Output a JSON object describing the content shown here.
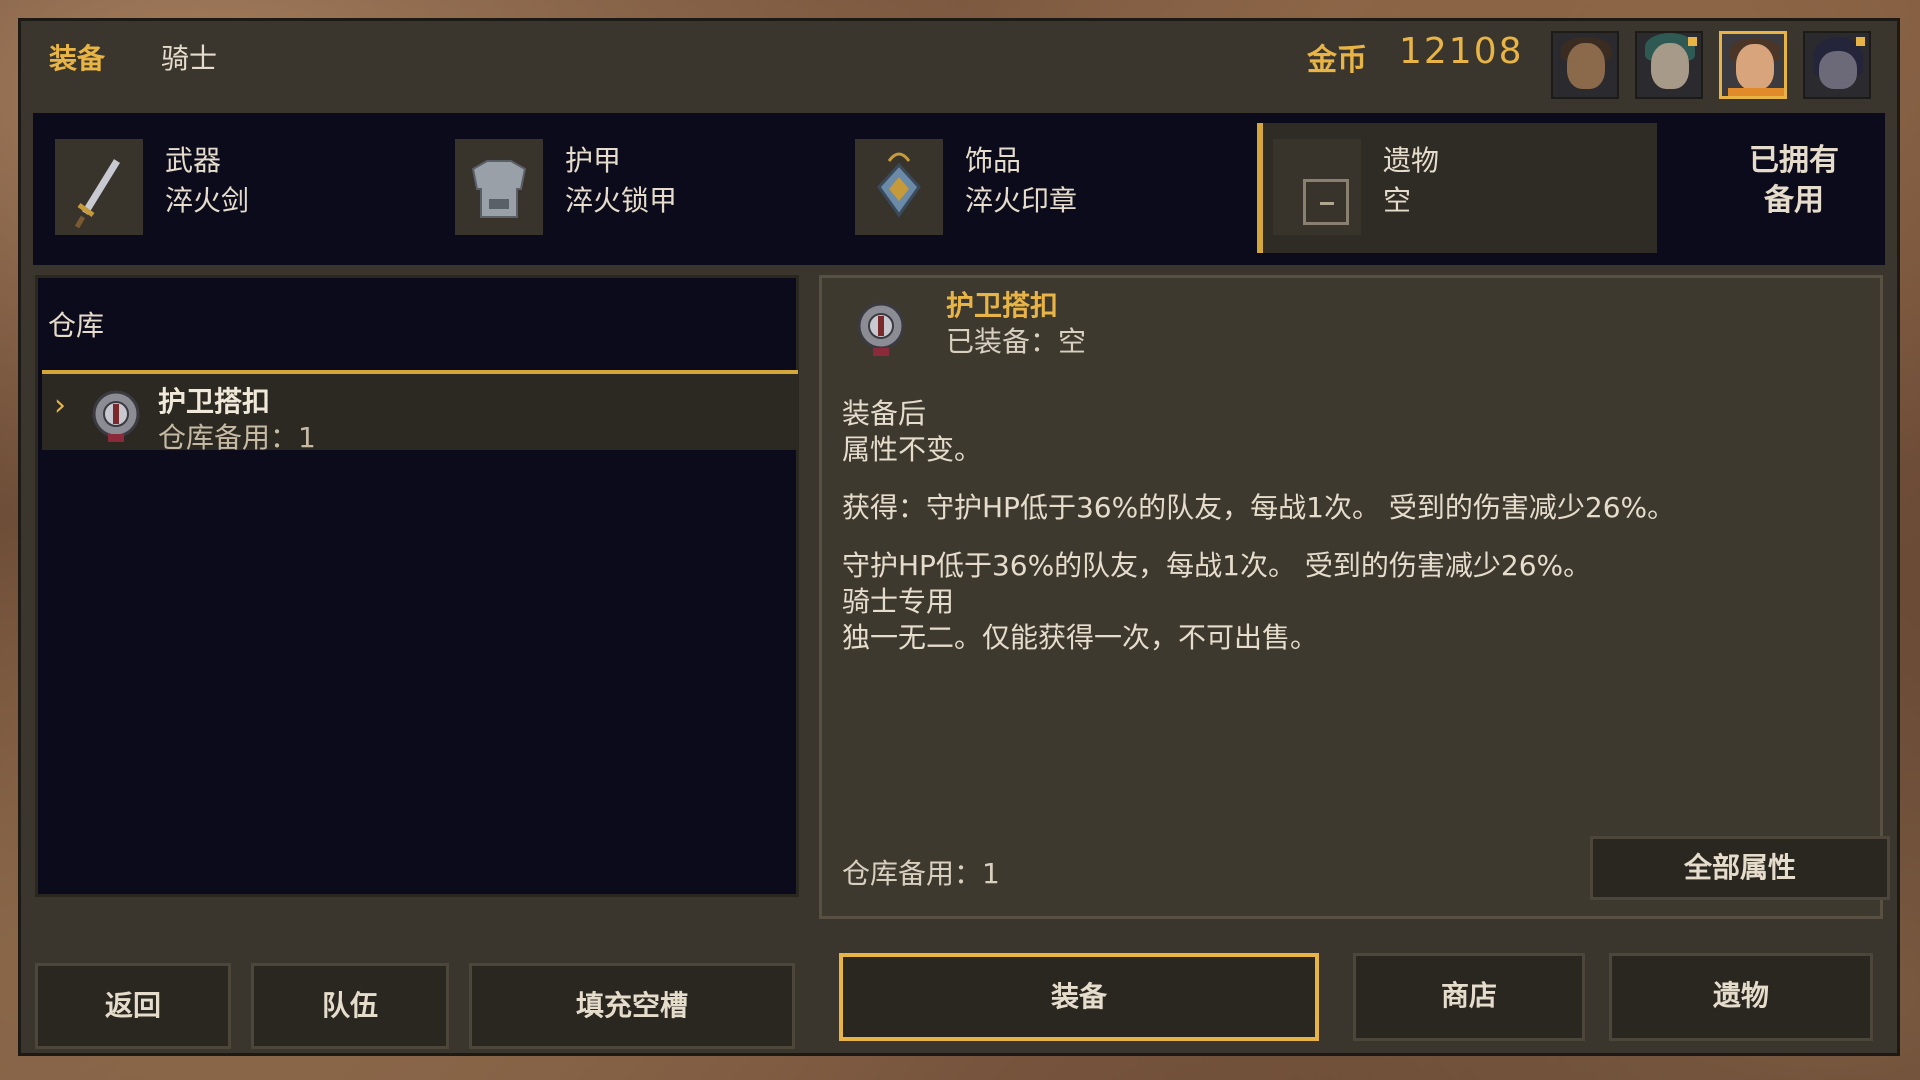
{
  "header": {
    "title": "装备",
    "character_class": "骑士",
    "gold_label": "金币",
    "gold_value": "12108"
  },
  "party": [
    {
      "name": "portrait-warrior",
      "selected": false
    },
    {
      "name": "portrait-mage",
      "selected": false
    },
    {
      "name": "portrait-knight",
      "selected": true
    },
    {
      "name": "portrait-rogue",
      "selected": false
    }
  ],
  "equipment_slots": [
    {
      "slot": "武器",
      "value": "淬火剑",
      "icon": "sword-icon"
    },
    {
      "slot": "护甲",
      "value": "淬火锁甲",
      "icon": "chainmail-icon"
    },
    {
      "slot": "饰品",
      "value": "淬火印章",
      "icon": "amulet-icon"
    },
    {
      "slot": "遗物",
      "value": "空",
      "icon": "empty-slot-icon"
    }
  ],
  "owned_label_line1": "已拥有",
  "owned_label_line2": "备用",
  "warehouse": {
    "title": "仓库",
    "items": [
      {
        "name": "护卫搭扣",
        "count_label": "仓库备用：1",
        "icon": "guard-clasp-icon",
        "selected": true
      }
    ]
  },
  "detail": {
    "name": "护卫搭扣",
    "equipped_label": "已装备：空",
    "after_equip_title": "装备后",
    "after_equip_text": "属性不变。",
    "gain_text": "获得：守护HP低于36%的队友，每战1次。 受到的伤害减少26%。",
    "desc_line1": "守护HP低于36%的队友，每战1次。 受到的伤害减少26%。",
    "desc_line2": "骑士专用",
    "desc_line3": "独一无二。仅能获得一次，不可出售。",
    "storage_label": "仓库备用：1",
    "all_attributes_button": "全部属性"
  },
  "bottom_buttons": {
    "back": "返回",
    "team": "队伍",
    "fill_empty": "填充空槽",
    "equip": "装备",
    "shop": "商店",
    "relic": "遗物"
  },
  "colors": {
    "accent_gold": "#e8b445",
    "panel_dark": "#0c0b1b",
    "window_bg": "#3a362d"
  }
}
